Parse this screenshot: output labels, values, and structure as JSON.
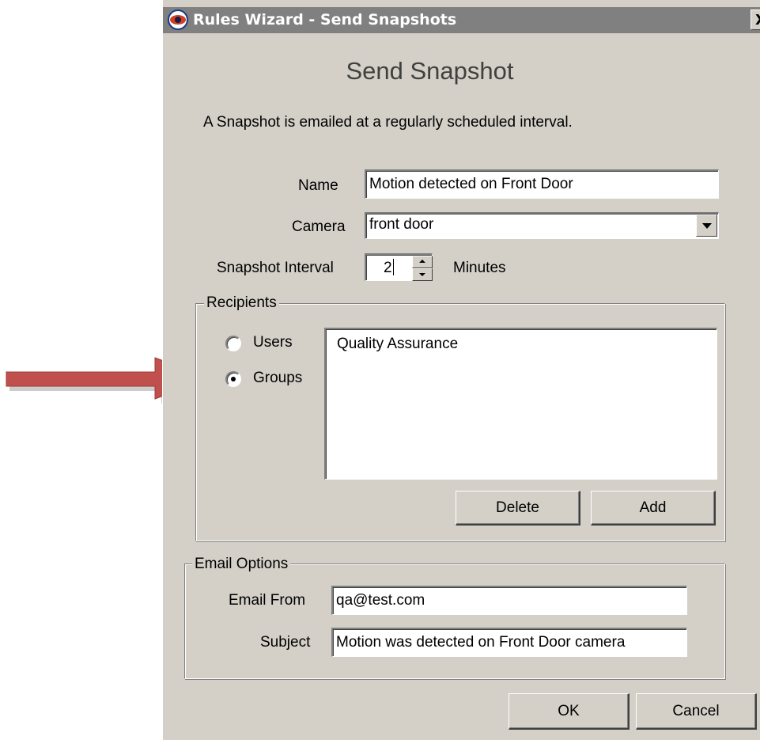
{
  "window": {
    "title": "Rules Wizard - Send Snapshots",
    "close_label": "X"
  },
  "header": {
    "heading": "Send Snapshot",
    "description": "A Snapshot is emailed at a regularly scheduled interval."
  },
  "form": {
    "name_label": "Name",
    "name_value": "Motion detected on Front Door",
    "camera_label": "Camera",
    "camera_value": "front door",
    "interval_label": "Snapshot Interval",
    "interval_value": "2",
    "interval_unit": "Minutes"
  },
  "recipients": {
    "group_label": "Recipients",
    "option_users": "Users",
    "option_groups": "Groups",
    "selected_option": "Groups",
    "list_items": [
      "Quality Assurance"
    ],
    "delete_label": "Delete",
    "add_label": "Add"
  },
  "email_options": {
    "group_label": "Email Options",
    "from_label": "Email From",
    "from_value": "qa@test.com",
    "subject_label": "Subject",
    "subject_value": "Motion was detected on Front Door camera"
  },
  "footer": {
    "ok_label": "OK",
    "cancel_label": "Cancel"
  },
  "colors": {
    "dialog_bg": "#d4d0c8",
    "titlebar_bg": "#808080",
    "annotation_arrow": "#c0504d"
  },
  "icons": {
    "app": "eye-icon",
    "annotation": "red-arrow-icon"
  }
}
